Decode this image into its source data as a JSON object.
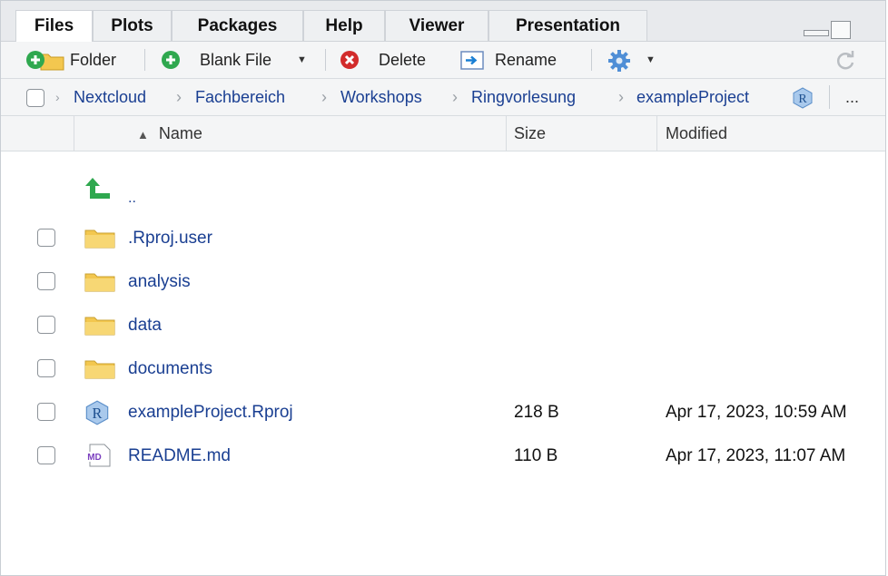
{
  "tabs": [
    {
      "label": "Files",
      "active": true
    },
    {
      "label": "Plots"
    },
    {
      "label": "Packages"
    },
    {
      "label": "Help"
    },
    {
      "label": "Viewer"
    },
    {
      "label": "Presentation"
    }
  ],
  "toolbar": {
    "new_folder": "Folder",
    "blank_file": "Blank File",
    "delete": "Delete",
    "rename": "Rename"
  },
  "breadcrumb": {
    "items": [
      "Nextcloud",
      "Fachbereich",
      "Workshops",
      "Ringvorlesung",
      "exampleProject"
    ],
    "more": "..."
  },
  "columns": {
    "name": "Name",
    "size": "Size",
    "modified": "Modified"
  },
  "parent_dir": "..",
  "files": [
    {
      "name": ".Rproj.user",
      "type": "folder",
      "size": "",
      "modified": ""
    },
    {
      "name": "analysis",
      "type": "folder",
      "size": "",
      "modified": ""
    },
    {
      "name": "data",
      "type": "folder",
      "size": "",
      "modified": ""
    },
    {
      "name": "documents",
      "type": "folder",
      "size": "",
      "modified": ""
    },
    {
      "name": "exampleProject.Rproj",
      "type": "rproj",
      "size": "218 B",
      "modified": "Apr 17, 2023, 10:59 AM"
    },
    {
      "name": "README.md",
      "type": "md",
      "size": "110 B",
      "modified": "Apr 17, 2023, 11:07 AM"
    }
  ],
  "colors": {
    "link": "#1a3f92",
    "accent_green": "#2fa84f",
    "delete_red": "#d22b2b",
    "folder_yellow": "#f3c74f"
  }
}
